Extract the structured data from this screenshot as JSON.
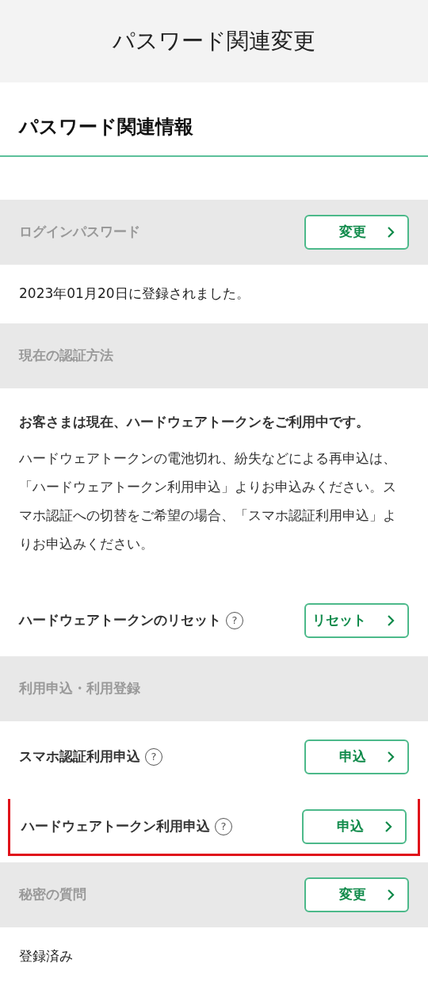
{
  "header": {
    "title": "パスワード関連変更"
  },
  "section_title": "パスワード関連情報",
  "sections": [
    {
      "label": "ログインパスワード",
      "button": "変更",
      "items": [
        {
          "kind": "text",
          "text": "2023年01月20日に登録されました。"
        }
      ]
    },
    {
      "label": "現在の認証方法",
      "items": [
        {
          "kind": "paragraphs",
          "lead": "お客さまは現在、ハードウェアトークンをご利用中です。",
          "text": "ハードウェアトークンの電池切れ、紛失などによる再申込は、「ハードウェアトークン利用申込」よりお申込みください。スマホ認証への切替をご希望の場合、「スマホ認証利用申込」よりお申込みください。"
        },
        {
          "kind": "action",
          "label": "ハードウェアトークンのリセット",
          "help": "?",
          "button": "リセット",
          "highlighted": false
        }
      ]
    },
    {
      "label": "利用申込・利用登録",
      "items": [
        {
          "kind": "action",
          "label": "スマホ認証利用申込",
          "help": "?",
          "button": "申込",
          "highlighted": false
        },
        {
          "kind": "action",
          "label": "ハードウェアトークン利用申込",
          "help": "?",
          "button": "申込",
          "highlighted": true
        }
      ]
    },
    {
      "label": "秘密の質問",
      "button": "変更",
      "items": [
        {
          "kind": "text",
          "text": "登録済み"
        }
      ]
    }
  ]
}
